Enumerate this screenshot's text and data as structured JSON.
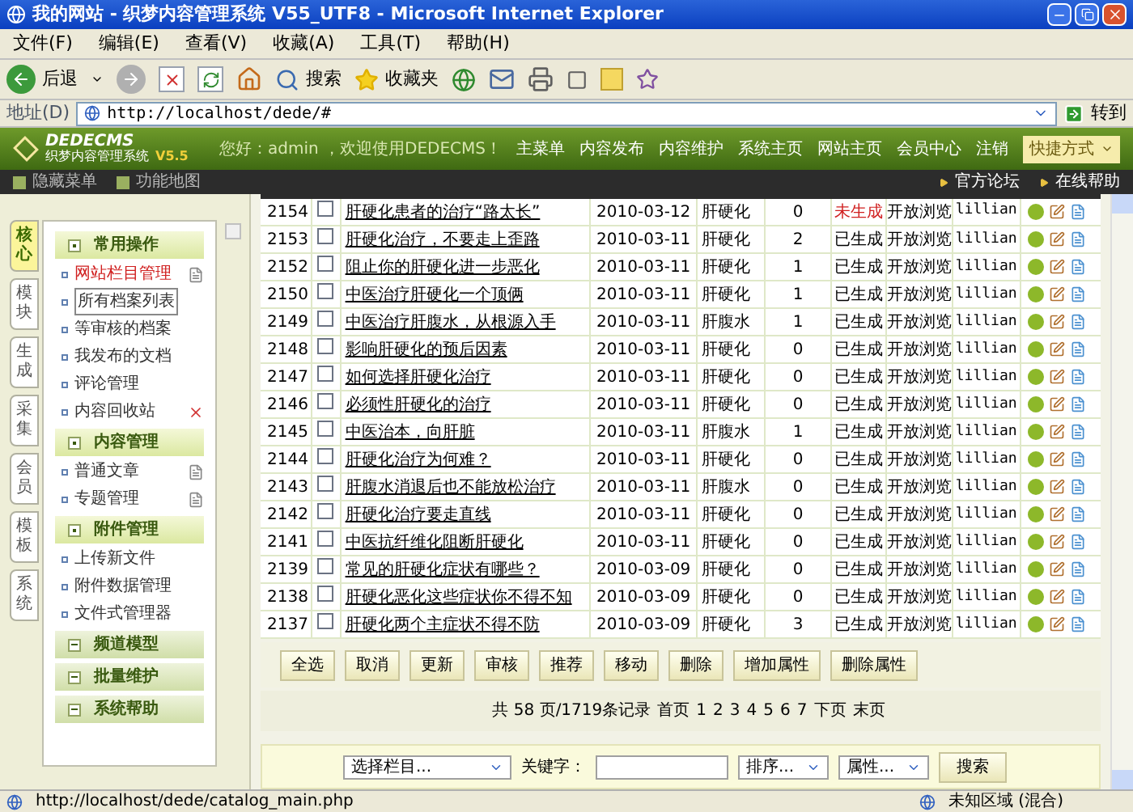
{
  "window": {
    "title": "我的网站 - 织梦内容管理系统 V55_UTF8 - Microsoft Internet Explorer"
  },
  "menu": [
    "文件(F)",
    "编辑(E)",
    "查看(V)",
    "收藏(A)",
    "工具(T)",
    "帮助(H)"
  ],
  "toolbar": {
    "back": "后退",
    "search": "搜索",
    "favorites": "收藏夹"
  },
  "address": {
    "label": "地址(D)",
    "url": "http://localhost/dede/#",
    "go": "转到"
  },
  "header": {
    "logo": "DEDECMS",
    "subtitle": "织梦内容管理系统",
    "version": "V5.5",
    "greeting": "您好：admin ，欢迎使用DEDECMS！",
    "nav": [
      "主菜单",
      "内容发布",
      "内容维护",
      "系统主页",
      "网站主页",
      "会员中心",
      "注销"
    ],
    "shortcut": "快捷方式"
  },
  "subbar": {
    "left": [
      "隐藏菜单",
      "功能地图"
    ],
    "right": [
      "官方论坛",
      "在线帮助"
    ]
  },
  "side_tabs": [
    {
      "label": "核心",
      "selected": true
    },
    {
      "label": "模块",
      "selected": false
    },
    {
      "label": "生成",
      "selected": false
    },
    {
      "label": "采集",
      "selected": false
    },
    {
      "label": "会员",
      "selected": false
    },
    {
      "label": "模板",
      "selected": false
    },
    {
      "label": "系统",
      "selected": false
    }
  ],
  "menu_groups": [
    {
      "title": "常用操作",
      "expanded": true,
      "items": [
        {
          "label": "网站栏目管理",
          "selected": true,
          "focused": false,
          "kind": "add"
        },
        {
          "label": "所有档案列表",
          "selected": false,
          "focused": true
        },
        {
          "label": "等审核的档案",
          "selected": false,
          "focused": false
        },
        {
          "label": "我发布的文档",
          "selected": false,
          "focused": false
        },
        {
          "label": "评论管理",
          "selected": false,
          "focused": false
        },
        {
          "label": "内容回收站",
          "selected": false,
          "focused": false,
          "kind": "delete"
        }
      ]
    },
    {
      "title": "内容管理",
      "expanded": true,
      "items": [
        {
          "label": "普通文章",
          "selected": false,
          "focused": false,
          "kind": "add"
        },
        {
          "label": "专题管理",
          "selected": false,
          "focused": false,
          "kind": "add"
        }
      ]
    },
    {
      "title": "附件管理",
      "expanded": true,
      "items": [
        {
          "label": "上传新文件",
          "selected": false,
          "focused": false
        },
        {
          "label": "附件数据管理",
          "selected": false,
          "focused": false
        },
        {
          "label": "文件式管理器",
          "selected": false,
          "focused": false
        }
      ]
    },
    {
      "title": "频道模型",
      "expanded": false
    },
    {
      "title": "批量维护",
      "expanded": false
    },
    {
      "title": "系统帮助",
      "expanded": false
    }
  ],
  "table": {
    "rows": [
      {
        "id": "2154",
        "title": "肝硬化患者的治疗“路太长”",
        "date": "2010-03-12",
        "category": "肝硬化",
        "clicks": "0",
        "status": "未生成",
        "generated": false,
        "access": "开放浏览",
        "author": "lillian",
        "checked": false
      },
      {
        "id": "2153",
        "title": "肝硬化治疗，不要走上歪路",
        "date": "2010-03-11",
        "category": "肝硬化",
        "clicks": "2",
        "status": "已生成",
        "generated": true,
        "access": "开放浏览",
        "author": "lillian",
        "checked": false
      },
      {
        "id": "2152",
        "title": "阻止你的肝硬化进一步恶化",
        "date": "2010-03-11",
        "category": "肝硬化",
        "clicks": "1",
        "status": "已生成",
        "generated": true,
        "access": "开放浏览",
        "author": "lillian",
        "checked": false
      },
      {
        "id": "2150",
        "title": "中医治疗肝硬化一个顶俩",
        "date": "2010-03-11",
        "category": "肝硬化",
        "clicks": "1",
        "status": "已生成",
        "generated": true,
        "access": "开放浏览",
        "author": "lillian",
        "checked": false
      },
      {
        "id": "2149",
        "title": "中医治疗肝腹水，从根源入手",
        "date": "2010-03-11",
        "category": "肝腹水",
        "clicks": "1",
        "status": "已生成",
        "generated": true,
        "access": "开放浏览",
        "author": "lillian",
        "checked": false
      },
      {
        "id": "2148",
        "title": "影响肝硬化的预后因素",
        "date": "2010-03-11",
        "category": "肝硬化",
        "clicks": "0",
        "status": "已生成",
        "generated": true,
        "access": "开放浏览",
        "author": "lillian",
        "checked": false
      },
      {
        "id": "2147",
        "title": "如何选择肝硬化治疗",
        "date": "2010-03-11",
        "category": "肝硬化",
        "clicks": "0",
        "status": "已生成",
        "generated": true,
        "access": "开放浏览",
        "author": "lillian",
        "checked": false
      },
      {
        "id": "2146",
        "title": "必须性肝硬化的治疗",
        "date": "2010-03-11",
        "category": "肝硬化",
        "clicks": "0",
        "status": "已生成",
        "generated": true,
        "access": "开放浏览",
        "author": "lillian",
        "checked": false
      },
      {
        "id": "2145",
        "title": "中医治本，向肝脏",
        "date": "2010-03-11",
        "category": "肝腹水",
        "clicks": "1",
        "status": "已生成",
        "generated": true,
        "access": "开放浏览",
        "author": "lillian",
        "checked": false
      },
      {
        "id": "2144",
        "title": "肝硬化治疗为何难？",
        "date": "2010-03-11",
        "category": "肝硬化",
        "clicks": "0",
        "status": "已生成",
        "generated": true,
        "access": "开放浏览",
        "author": "lillian",
        "checked": false
      },
      {
        "id": "2143",
        "title": "肝腹水消退后也不能放松治疗",
        "date": "2010-03-11",
        "category": "肝腹水",
        "clicks": "0",
        "status": "已生成",
        "generated": true,
        "access": "开放浏览",
        "author": "lillian",
        "checked": false
      },
      {
        "id": "2142",
        "title": "肝硬化治疗要走直线",
        "date": "2010-03-11",
        "category": "肝硬化",
        "clicks": "0",
        "status": "已生成",
        "generated": true,
        "access": "开放浏览",
        "author": "lillian",
        "checked": false
      },
      {
        "id": "2141",
        "title": "中医抗纤维化阻断肝硬化",
        "date": "2010-03-11",
        "category": "肝硬化",
        "clicks": "0",
        "status": "已生成",
        "generated": true,
        "access": "开放浏览",
        "author": "lillian",
        "checked": false
      },
      {
        "id": "2139",
        "title": "常见的肝硬化症状有哪些？",
        "date": "2010-03-09",
        "category": "肝硬化",
        "clicks": "0",
        "status": "已生成",
        "generated": true,
        "access": "开放浏览",
        "author": "lillian",
        "checked": false
      },
      {
        "id": "2138",
        "title": "肝硬化恶化这些症状你不得不知",
        "date": "2010-03-09",
        "category": "肝硬化",
        "clicks": "0",
        "status": "已生成",
        "generated": true,
        "access": "开放浏览",
        "author": "lillian",
        "checked": false
      },
      {
        "id": "2137",
        "title": "肝硬化两个主症状不得不防",
        "date": "2010-03-09",
        "category": "肝硬化",
        "clicks": "3",
        "status": "已生成",
        "generated": true,
        "access": "开放浏览",
        "author": "lillian",
        "checked": false
      }
    ]
  },
  "actions": [
    "全选",
    "取消",
    "更新",
    "审核",
    "推荐",
    "移动",
    "删除",
    "增加属性",
    "删除属性"
  ],
  "pagination": {
    "summary": "共 58 页/1719条记录",
    "first": "首页",
    "pages": [
      "1",
      "2",
      "3",
      "4",
      "5",
      "6",
      "7"
    ],
    "next": "下页",
    "last": "末页"
  },
  "search": {
    "column": "选择栏目...",
    "keyword_label": "关键字：",
    "order": "排序...",
    "attribute": "属性...",
    "button": "搜索"
  },
  "status_bar": {
    "url": "http://localhost/dede/catalog_main.php",
    "zone": "未知区域 (混合)"
  }
}
